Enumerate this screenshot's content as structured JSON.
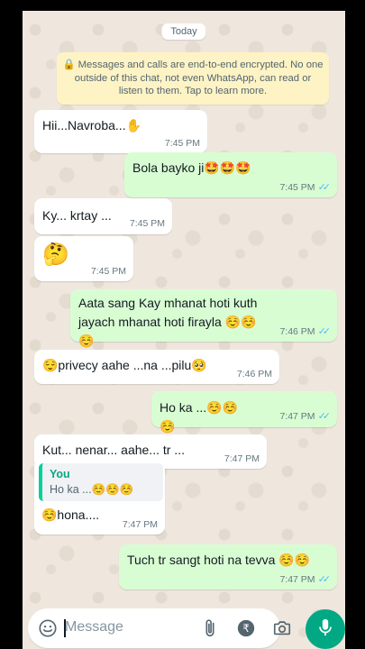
{
  "chat": {
    "date_label": "Today",
    "encryption_notice": "🔒 Messages and calls are end-to-end encrypted. No one outside of this chat, not even WhatsApp, can read or listen to them. Tap to learn more.",
    "messages": [
      {
        "dir": "in",
        "text": "Hii...Navroba...✋",
        "time": "7:45 PM"
      },
      {
        "dir": "out",
        "text": "Bola bayko ji🤩🤩🤩",
        "time": "7:45 PM",
        "ticks": "✓✓"
      },
      {
        "dir": "in",
        "text": "Ky... krtay ...",
        "time": "7:45 PM"
      },
      {
        "dir": "in",
        "text": "🤔",
        "time": "7:45 PM"
      },
      {
        "dir": "out",
        "text": "Aata sang Kay mhanat hoti kuth jayach mhanat hoti firayla ☺️☺️☺️",
        "time": "7:46 PM",
        "ticks": "✓✓"
      },
      {
        "dir": "in",
        "text": "😌privecy aahe ...na ...pilu🥺",
        "time": "7:46 PM"
      },
      {
        "dir": "out",
        "text": "Ho ka ...☺️☺️☺️",
        "time": "7:47 PM",
        "ticks": "✓✓"
      },
      {
        "dir": "in",
        "text": "Kut... nenar... aahe... tr ...🤔",
        "time": "7:47 PM"
      },
      {
        "dir": "in",
        "text": "☺️hona....",
        "time": "7:47 PM",
        "reply_author": "You",
        "reply_text": "Ho ka ...☺️☺️☺️"
      },
      {
        "dir": "out",
        "text": "Tuch tr sangt hoti na tevva ☺️☺️",
        "time": "7:47 PM",
        "ticks": "✓✓"
      }
    ]
  },
  "composer": {
    "placeholder": "Message",
    "icons": [
      "emoji-icon",
      "attach-icon",
      "rupee-icon",
      "camera-icon",
      "mic-icon"
    ]
  },
  "colors": {
    "background": "#efe7de",
    "outgoing": "#d9fdd3",
    "incoming": "#ffffff",
    "accent": "#00a884",
    "read_ticks": "#53bdeb"
  }
}
